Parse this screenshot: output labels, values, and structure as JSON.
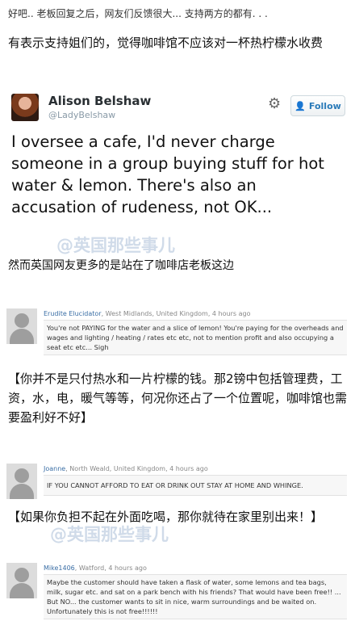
{
  "intro": {
    "line1": "好吧.. 老板回复之后，网友们反馈很大...  支持两方的都有. . .",
    "line2": "有表示支持姐们的，觉得咖啡馆不应该对一杯热柠檬水收费"
  },
  "tweet": {
    "name": "Alison Belshaw",
    "handle": "@LadyBelshaw",
    "follow_label": "Follow",
    "text": "I oversee a cafe, I'd never charge someone in a group buying stuff for hot water & lemon. There's also an accusation of rudeness, not OK..."
  },
  "watermark": "@英国那些事儿",
  "caption1": "然而英国网友更多的是站在了咖啡店老板这边",
  "comments": [
    {
      "user": "Erudite Elucidator",
      "meta": ", West Midlands, United Kingdom, 4 hours ago",
      "text": "You're not PAYING for the water and a slice of lemon! You're paying for the overheads and wages and lighting / heating / rates etc etc, not to mention profit and also occupying a seat etc etc... Sigh"
    },
    {
      "user": "Joanne",
      "meta": ", North Weald, United Kingdom, 4 hours ago",
      "text": "IF YOU CANNOT AFFORD TO EAT OR DRINK OUT STAY AT HOME AND WHINGE."
    },
    {
      "user": "Mike1406",
      "meta": ", Watford, 4 hours ago",
      "text": "Maybe the customer should have taken a flask of water, some lemons and tea bags, milk, sugar etc. and sat on a park bench with his friends? That would have been free!! ... But NO... the customer wants to sit in nice, warm surroundings and be waited on. Unfortunately this is not free!!!!!!"
    }
  ],
  "translation1": "【你并不是只付热水和一片柠檬的钱。那2镑中包括管理费，工资，水，电，暖气等等，何况你还占了一个位置呢，咖啡馆也需要盈利好不好】",
  "translation2": "【如果你负担不起在外面吃喝，那你就待在家里别出来！】"
}
